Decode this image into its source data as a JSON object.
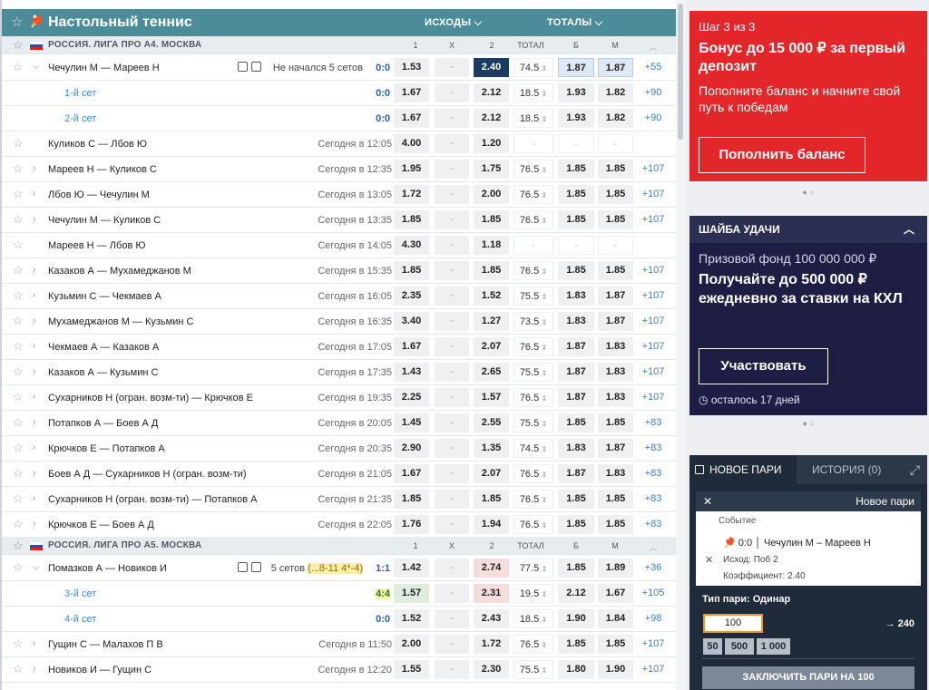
{
  "sport": {
    "title": "Настольный теннис",
    "markets": [
      "ИСХОДЫ ⌵",
      "ТОТАЛЫ ⌵"
    ]
  },
  "league1": {
    "name": "РОССИЯ. ЛИГА ПРО А4. МОСКВА",
    "headers": [
      "1",
      "X",
      "2",
      "ТОТАЛ",
      "Б",
      "М"
    ]
  },
  "league2": {
    "name": "РОССИЯ. ЛИГА ПРО А5. МОСКВА",
    "headers": [
      "1",
      "X",
      "2",
      "ТОТАЛ",
      "Б",
      "М"
    ]
  },
  "events": [
    {
      "name": "Чечулин М — Мареев Н",
      "live": "Не начался 5 сетов",
      "score": "0:0",
      "k1": "1.53",
      "kx": "-",
      "k2": "2.40",
      "tot": "74.5",
      "b": "1.87",
      "m": "1.87",
      "ex": "+55"
    },
    {
      "set": "1-й сет",
      "score": "0:0",
      "k1": "1.67",
      "kx": "-",
      "k2": "2.12",
      "tot": "18.5",
      "b": "1.93",
      "m": "1.82",
      "ex": "+90"
    },
    {
      "set": "2-й сет",
      "score": "0:0",
      "k1": "1.67",
      "kx": "-",
      "k2": "2.12",
      "tot": "18.5",
      "b": "1.93",
      "m": "1.82",
      "ex": "+90"
    },
    {
      "name": "Куликов С — Лбов Ю",
      "time": "Сегодня в 12:05",
      "k1": "4.00",
      "kx": "-",
      "k2": "1.20",
      "tot": "-",
      "b": "-",
      "m": "-",
      "ex": ""
    },
    {
      "name": "Мареев Н — Куликов С",
      "time": "Сегодня в 12:35",
      "k1": "1.95",
      "kx": "-",
      "k2": "1.75",
      "tot": "76.5",
      "b": "1.85",
      "m": "1.85",
      "ex": "+107"
    },
    {
      "name": "Лбов Ю — Чечулин М",
      "time": "Сегодня в 13:05",
      "k1": "1.72",
      "kx": "-",
      "k2": "2.00",
      "tot": "76.5",
      "b": "1.85",
      "m": "1.85",
      "ex": "+107"
    },
    {
      "name": "Чечулин М — Куликов С",
      "time": "Сегодня в 13:35",
      "k1": "1.85",
      "kx": "-",
      "k2": "1.85",
      "tot": "76.5",
      "b": "1.85",
      "m": "1.85",
      "ex": "+107"
    },
    {
      "name": "Мареев Н — Лбов Ю",
      "time": "Сегодня в 14:05",
      "k1": "4.30",
      "kx": "-",
      "k2": "1.18",
      "tot": "-",
      "b": "-",
      "m": "-",
      "ex": ""
    },
    {
      "name": "Казаков А — Мухамеджанов М",
      "time": "Сегодня в 15:35",
      "k1": "1.85",
      "kx": "-",
      "k2": "1.85",
      "tot": "76.5",
      "b": "1.85",
      "m": "1.85",
      "ex": "+107"
    },
    {
      "name": "Кузьмин С — Чекмаев А",
      "time": "Сегодня в 16:05",
      "k1": "2.35",
      "kx": "-",
      "k2": "1.52",
      "tot": "75.5",
      "b": "1.83",
      "m": "1.87",
      "ex": "+107"
    },
    {
      "name": "Мухамеджанов М — Кузьмин С",
      "time": "Сегодня в 16:35",
      "k1": "3.40",
      "kx": "-",
      "k2": "1.27",
      "tot": "73.5",
      "b": "1.83",
      "m": "1.87",
      "ex": "+107"
    },
    {
      "name": "Чекмаев А — Казаков А",
      "time": "Сегодня в 17:05",
      "k1": "1.67",
      "kx": "-",
      "k2": "2.07",
      "tot": "76.5",
      "b": "1.87",
      "m": "1.83",
      "ex": "+107"
    },
    {
      "name": "Казаков А — Кузьмин С",
      "time": "Сегодня в 17:35",
      "k1": "1.43",
      "kx": "-",
      "k2": "2.65",
      "tot": "75.5",
      "b": "1.87",
      "m": "1.83",
      "ex": "+107"
    },
    {
      "name": "Сухарников Н (огран. возм-ти) — Крючков Е",
      "time": "Сегодня в 19:35",
      "k1": "2.25",
      "kx": "-",
      "k2": "1.57",
      "tot": "76.5",
      "b": "1.87",
      "m": "1.83",
      "ex": "+107"
    },
    {
      "name": "Потапков А — Боев А Д",
      "time": "Сегодня в 20:05",
      "k1": "1.45",
      "kx": "-",
      "k2": "2.55",
      "tot": "75.5",
      "b": "1.85",
      "m": "1.85",
      "ex": "+83"
    },
    {
      "name": "Крючков Е — Потапков А",
      "time": "Сегодня в 20:35",
      "k1": "2.90",
      "kx": "-",
      "k2": "1.35",
      "tot": "74.5",
      "b": "1.83",
      "m": "1.87",
      "ex": "+83"
    },
    {
      "name": "Боев А Д — Сухарников Н (огран. возм-ти)",
      "time": "Сегодня в 21:05",
      "k1": "1.67",
      "kx": "-",
      "k2": "2.07",
      "tot": "76.5",
      "b": "1.87",
      "m": "1.83",
      "ex": "+83"
    },
    {
      "name": "Сухарников Н (огран. возм-ти) — Потапков А",
      "time": "Сегодня в 21:35",
      "k1": "1.85",
      "kx": "-",
      "k2": "1.85",
      "tot": "76.5",
      "b": "1.85",
      "m": "1.85",
      "ex": "+83"
    },
    {
      "name": "Крючков Е — Боев А Д",
      "time": "Сегодня в 22:05",
      "k1": "1.76",
      "kx": "-",
      "k2": "1.94",
      "tot": "76.5",
      "b": "1.85",
      "m": "1.85",
      "ex": "+83"
    },
    {
      "name": "Помазков А — Новиков И",
      "live": "5 сетов",
      "live2": "(...8-11 4*-4)",
      "score": "1:1",
      "k1": "1.42",
      "kx": "-",
      "k2": "2.74",
      "tot": "77.5",
      "b": "1.85",
      "m": "1.89",
      "ex": "+36"
    },
    {
      "set": "3-й сет",
      "score": "4:4",
      "k1": "1.57",
      "kx": "-",
      "k2": "2.31",
      "tot": "19.5",
      "b": "2.12",
      "m": "1.67",
      "ex": "+105"
    },
    {
      "set": "4-й сет",
      "score": "0:0",
      "k1": "1.52",
      "kx": "-",
      "k2": "2.43",
      "tot": "18.5",
      "b": "1.90",
      "m": "1.84",
      "ex": "+98"
    },
    {
      "name": "Гущин С — Малахов П В",
      "time": "Сегодня в 11:50",
      "k1": "2.00",
      "kx": "-",
      "k2": "1.72",
      "tot": "76.5",
      "b": "1.85",
      "m": "1.85",
      "ex": "+107"
    },
    {
      "name": "Новиков И — Гущин С",
      "time": "Сегодня в 12:20",
      "k1": "1.55",
      "kx": "-",
      "k2": "2.30",
      "tot": "75.5",
      "b": "1.80",
      "m": "1.90",
      "ex": "+107"
    }
  ],
  "promo1": {
    "step": "Шаг 3 из 3",
    "title": "Бонус до 15 000 ₽ за первый депозит",
    "desc": "Пополните баланс и начните свой путь к победам",
    "button": "Пополнить баланс"
  },
  "promo2": {
    "header": "ШАЙБА УДАЧИ",
    "fund": "Призовой фонд 100 000 000 ₽",
    "title": "Получайте до 500 000 ₽ ежедневно за ставки на КХЛ",
    "button": "Участвовать",
    "left": "осталось 17 дней"
  },
  "slip": {
    "tab_new": "НОВОЕ ПАРИ",
    "tab_history": "ИСТОРИЯ (0)",
    "panel_title": "Новое пари",
    "event_label": "Событие",
    "match": "0:0 │ Чечулин М – Мареев Н",
    "outcome": "Исход: Поб 2",
    "coef": "Коэффициент: 2.40",
    "type": "Тип пари: Одинар",
    "amount": "100",
    "ret": "→ 240",
    "quick": [
      "50",
      "500",
      "1 000"
    ],
    "submit": "ЗАКЛЮЧИТЬ ПАРИ НА 100"
  }
}
